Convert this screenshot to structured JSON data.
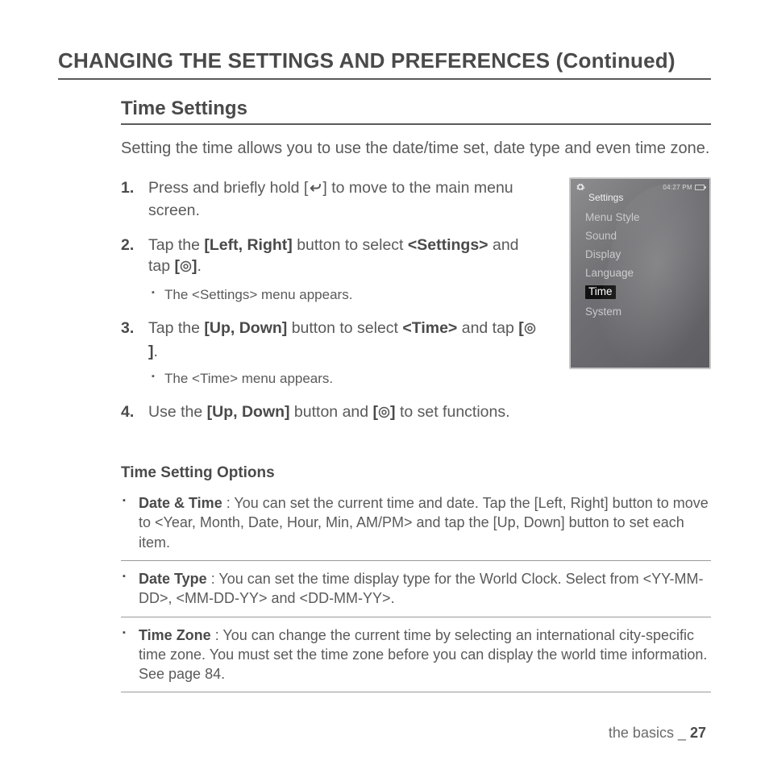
{
  "page_title": "CHANGING THE SETTINGS AND PREFERENCES (Continued)",
  "section_title": "Time Settings",
  "intro": "Setting the time allows you to use the date/time set, date type and even time zone.",
  "steps": [
    {
      "num": "1.",
      "pre": "Press and briefly hold [",
      "post": "] to move to the main menu screen."
    },
    {
      "num": "2.",
      "t1": "Tap the ",
      "b1": "[Left, Right]",
      "t2": " button to select ",
      "b2": "<Settings>",
      "t3": " and tap ",
      "b3a": "[",
      "b3b": "]",
      "t4": ".",
      "sub": "The <Settings> menu appears."
    },
    {
      "num": "3.",
      "t1": "Tap the ",
      "b1": "[Up, Down]",
      "t2": " button to select ",
      "b2": "<Time>",
      "t3": " and tap ",
      "b3a": "[",
      "b3b": "]",
      "t4": ".",
      "sub": "The <Time> menu appears."
    },
    {
      "num": "4.",
      "t1": "Use the ",
      "b1": "[Up, Down]",
      "t2": " button and ",
      "b3a": "[",
      "b3b": "]",
      "t3": " to set functions."
    }
  ],
  "options_title": "Time Setting Options",
  "options": [
    {
      "label": "Date & Time",
      "desc": " : You can set the current time and date. Tap the [Left, Right] button to move to <Year, Month, Date, Hour, Min, AM/PM> and tap the [Up, Down] button to set each item."
    },
    {
      "label": "Date Type",
      "desc": " : You can set the time display type for the World Clock. Select from <YY-MM-DD>, <MM-DD-YY> and <DD-MM-YY>."
    },
    {
      "label": "Time Zone",
      "desc": " : You can change the current time by selecting an international city-specific time zone. You must set the time zone before you can display the world time information. See page 84."
    }
  ],
  "device": {
    "clock": "04:27 PM",
    "title": "Settings",
    "items": [
      "Menu Style",
      "Sound",
      "Display",
      "Language",
      "Time",
      "System"
    ],
    "selected_index": 4
  },
  "footer": {
    "section": "the basics",
    "sep": " _ ",
    "page": "27"
  }
}
